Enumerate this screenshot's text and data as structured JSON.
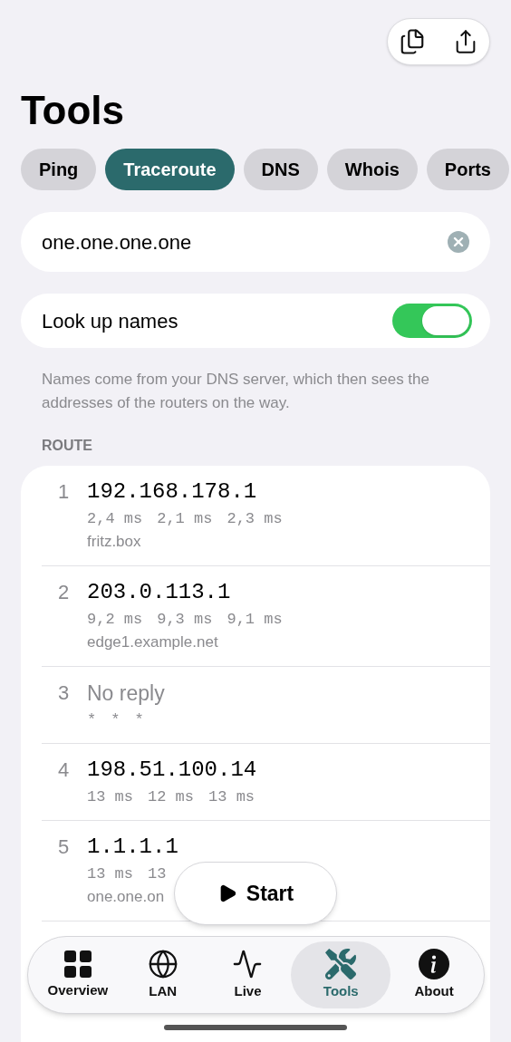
{
  "title": "Tools",
  "tabs": [
    {
      "label": "Ping",
      "selected": false
    },
    {
      "label": "Traceroute",
      "selected": true
    },
    {
      "label": "DNS",
      "selected": false
    },
    {
      "label": "Whois",
      "selected": false
    },
    {
      "label": "Ports",
      "selected": false
    }
  ],
  "host_field": {
    "value": "one.one.one.one"
  },
  "lookup_names": {
    "label": "Look up names",
    "on": true
  },
  "note": "Names come from your DNS server, which then sees the addresses of the routers on the way.",
  "route": {
    "heading": "ROUTE",
    "hops": [
      {
        "number": "1",
        "address": "192.168.178.1",
        "reply": true,
        "times": [
          "2,4 ms",
          "2,1 ms",
          "2,3 ms"
        ],
        "name": "fritz.box"
      },
      {
        "number": "2",
        "address": "203.0.113.1",
        "reply": true,
        "times": [
          "9,2 ms",
          "9,3 ms",
          "9,1 ms"
        ],
        "name": "edge1.example.net"
      },
      {
        "number": "3",
        "address": "No reply",
        "reply": false,
        "times": [
          "*",
          "*",
          "*"
        ]
      },
      {
        "number": "4",
        "address": "198.51.100.14",
        "reply": true,
        "times": [
          "13 ms",
          "12 ms",
          "13 ms"
        ]
      },
      {
        "number": "5",
        "address": "1.1.1.1",
        "reply": true,
        "times": [
          "13 ms",
          "13"
        ],
        "name": "one.one.on"
      }
    ]
  },
  "start_button": {
    "label": "Start"
  },
  "tab_bar": {
    "items": [
      {
        "label": "Overview",
        "selected": false
      },
      {
        "label": "LAN",
        "selected": false
      },
      {
        "label": "Live",
        "selected": false
      },
      {
        "label": "Tools",
        "selected": true
      },
      {
        "label": "About",
        "selected": false
      }
    ]
  }
}
